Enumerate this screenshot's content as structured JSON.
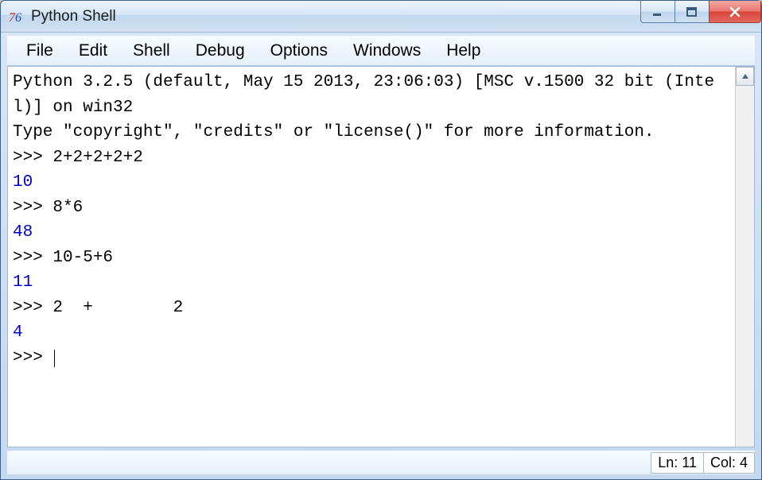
{
  "window": {
    "title": "Python Shell"
  },
  "menubar": {
    "items": [
      "File",
      "Edit",
      "Shell",
      "Debug",
      "Options",
      "Windows",
      "Help"
    ]
  },
  "terminal": {
    "banner_line1": "Python 3.2.5 (default, May 15 2013, 23:06:03) [MSC v.1500 32 bit (Intel)] on win32",
    "banner_line2": "Type \"copyright\", \"credits\" or \"license()\" for more information.",
    "prompt": ">>> ",
    "entries": [
      {
        "input": "2+2+2+2+2",
        "output": "10"
      },
      {
        "input": "8*6",
        "output": "48"
      },
      {
        "input": "10-5+6",
        "output": "11"
      },
      {
        "input": "2  +        2",
        "output": "4"
      }
    ]
  },
  "statusbar": {
    "line_label": "Ln: 11",
    "col_label": "Col: 4"
  }
}
